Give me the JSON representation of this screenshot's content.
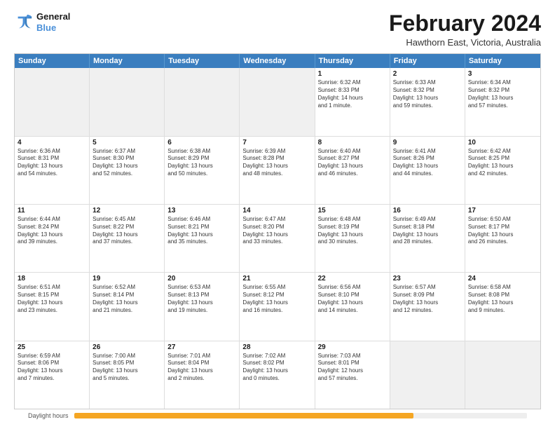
{
  "header": {
    "logo_line1": "General",
    "logo_line2": "Blue",
    "main_title": "February 2024",
    "subtitle": "Hawthorn East, Victoria, Australia"
  },
  "calendar": {
    "days_of_week": [
      "Sunday",
      "Monday",
      "Tuesday",
      "Wednesday",
      "Thursday",
      "Friday",
      "Saturday"
    ],
    "weeks": [
      [
        {
          "day": "",
          "content": ""
        },
        {
          "day": "",
          "content": ""
        },
        {
          "day": "",
          "content": ""
        },
        {
          "day": "",
          "content": ""
        },
        {
          "day": "1",
          "content": "Sunrise: 6:32 AM\nSunset: 8:33 PM\nDaylight: 14 hours\nand 1 minute."
        },
        {
          "day": "2",
          "content": "Sunrise: 6:33 AM\nSunset: 8:32 PM\nDaylight: 13 hours\nand 59 minutes."
        },
        {
          "day": "3",
          "content": "Sunrise: 6:34 AM\nSunset: 8:32 PM\nDaylight: 13 hours\nand 57 minutes."
        }
      ],
      [
        {
          "day": "4",
          "content": "Sunrise: 6:36 AM\nSunset: 8:31 PM\nDaylight: 13 hours\nand 54 minutes."
        },
        {
          "day": "5",
          "content": "Sunrise: 6:37 AM\nSunset: 8:30 PM\nDaylight: 13 hours\nand 52 minutes."
        },
        {
          "day": "6",
          "content": "Sunrise: 6:38 AM\nSunset: 8:29 PM\nDaylight: 13 hours\nand 50 minutes."
        },
        {
          "day": "7",
          "content": "Sunrise: 6:39 AM\nSunset: 8:28 PM\nDaylight: 13 hours\nand 48 minutes."
        },
        {
          "day": "8",
          "content": "Sunrise: 6:40 AM\nSunset: 8:27 PM\nDaylight: 13 hours\nand 46 minutes."
        },
        {
          "day": "9",
          "content": "Sunrise: 6:41 AM\nSunset: 8:26 PM\nDaylight: 13 hours\nand 44 minutes."
        },
        {
          "day": "10",
          "content": "Sunrise: 6:42 AM\nSunset: 8:25 PM\nDaylight: 13 hours\nand 42 minutes."
        }
      ],
      [
        {
          "day": "11",
          "content": "Sunrise: 6:44 AM\nSunset: 8:24 PM\nDaylight: 13 hours\nand 39 minutes."
        },
        {
          "day": "12",
          "content": "Sunrise: 6:45 AM\nSunset: 8:22 PM\nDaylight: 13 hours\nand 37 minutes."
        },
        {
          "day": "13",
          "content": "Sunrise: 6:46 AM\nSunset: 8:21 PM\nDaylight: 13 hours\nand 35 minutes."
        },
        {
          "day": "14",
          "content": "Sunrise: 6:47 AM\nSunset: 8:20 PM\nDaylight: 13 hours\nand 33 minutes."
        },
        {
          "day": "15",
          "content": "Sunrise: 6:48 AM\nSunset: 8:19 PM\nDaylight: 13 hours\nand 30 minutes."
        },
        {
          "day": "16",
          "content": "Sunrise: 6:49 AM\nSunset: 8:18 PM\nDaylight: 13 hours\nand 28 minutes."
        },
        {
          "day": "17",
          "content": "Sunrise: 6:50 AM\nSunset: 8:17 PM\nDaylight: 13 hours\nand 26 minutes."
        }
      ],
      [
        {
          "day": "18",
          "content": "Sunrise: 6:51 AM\nSunset: 8:15 PM\nDaylight: 13 hours\nand 23 minutes."
        },
        {
          "day": "19",
          "content": "Sunrise: 6:52 AM\nSunset: 8:14 PM\nDaylight: 13 hours\nand 21 minutes."
        },
        {
          "day": "20",
          "content": "Sunrise: 6:53 AM\nSunset: 8:13 PM\nDaylight: 13 hours\nand 19 minutes."
        },
        {
          "day": "21",
          "content": "Sunrise: 6:55 AM\nSunset: 8:12 PM\nDaylight: 13 hours\nand 16 minutes."
        },
        {
          "day": "22",
          "content": "Sunrise: 6:56 AM\nSunset: 8:10 PM\nDaylight: 13 hours\nand 14 minutes."
        },
        {
          "day": "23",
          "content": "Sunrise: 6:57 AM\nSunset: 8:09 PM\nDaylight: 13 hours\nand 12 minutes."
        },
        {
          "day": "24",
          "content": "Sunrise: 6:58 AM\nSunset: 8:08 PM\nDaylight: 13 hours\nand 9 minutes."
        }
      ],
      [
        {
          "day": "25",
          "content": "Sunrise: 6:59 AM\nSunset: 8:06 PM\nDaylight: 13 hours\nand 7 minutes."
        },
        {
          "day": "26",
          "content": "Sunrise: 7:00 AM\nSunset: 8:05 PM\nDaylight: 13 hours\nand 5 minutes."
        },
        {
          "day": "27",
          "content": "Sunrise: 7:01 AM\nSunset: 8:04 PM\nDaylight: 13 hours\nand 2 minutes."
        },
        {
          "day": "28",
          "content": "Sunrise: 7:02 AM\nSunset: 8:02 PM\nDaylight: 13 hours\nand 0 minutes."
        },
        {
          "day": "29",
          "content": "Sunrise: 7:03 AM\nSunset: 8:01 PM\nDaylight: 12 hours\nand 57 minutes."
        },
        {
          "day": "",
          "content": ""
        },
        {
          "day": "",
          "content": ""
        }
      ]
    ],
    "daylight_bar_label": "Daylight hours",
    "daylight_bar_percent": 75
  }
}
